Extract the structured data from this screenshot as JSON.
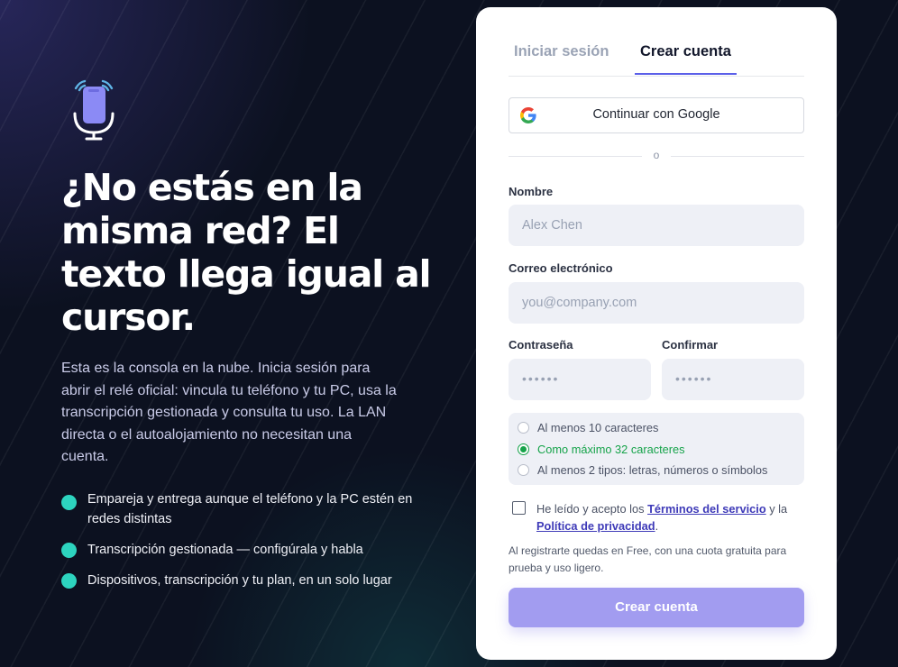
{
  "hero": {
    "title": "¿No estás en la misma red? El texto llega igual al cursor.",
    "description": "Esta es la consola en la nube. Inicia sesión para abrir el relé oficial: vincula tu teléfono y tu PC, usa la transcripción gestionada y consulta tu uso. La LAN directa o el autoalojamiento no necesitan una cuenta.",
    "features": [
      "Empareja y entrega aunque el teléfono y la PC estén en redes distintas",
      "Transcripción gestionada — configúrala y habla",
      "Dispositivos, transcripción y tu plan, en un solo lugar"
    ],
    "icon": "phone-microphone-icon"
  },
  "auth": {
    "tabs": {
      "login": "Iniciar sesión",
      "signup": "Crear cuenta",
      "active": "signup"
    },
    "google_label": "Continuar con Google",
    "divider": "o",
    "name": {
      "label": "Nombre",
      "placeholder": "Alex Chen"
    },
    "email": {
      "label": "Correo electrónico",
      "placeholder": "you@company.com"
    },
    "password": {
      "label": "Contraseña",
      "placeholder": "••••••"
    },
    "confirm": {
      "label": "Confirmar",
      "placeholder": "••••••"
    },
    "rules": [
      {
        "text": "Al menos 10 caracteres",
        "met": false
      },
      {
        "text": "Como máximo 32 caracteres",
        "met": true
      },
      {
        "text": "Al menos 2 tipos: letras, números o símbolos",
        "met": false
      }
    ],
    "terms": {
      "prefix": "He leído y acepto los",
      "terms_link": "Términos del servicio",
      "middle": "y la",
      "privacy_link": "Política de privacidad",
      "suffix": ".",
      "checked": false
    },
    "note": "Al registrarte quedas en Free, con una cuota gratuita para prueba y uso ligero.",
    "submit": "Crear cuenta"
  },
  "colors": {
    "background": "#0c1120",
    "accent": "#5b5fe9",
    "feature_dot": "#2dd4bf",
    "submit": "#a29cf0",
    "success": "#16a34a"
  }
}
